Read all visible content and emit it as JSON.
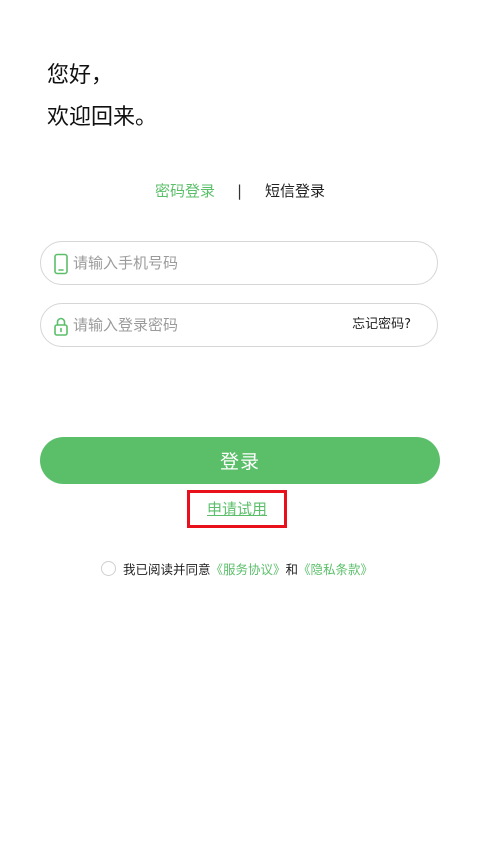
{
  "greeting": {
    "line1": "您好，",
    "line2": "欢迎回来。"
  },
  "login_tabs": {
    "password_label": "密码登录",
    "divider": "|",
    "sms_label": "短信登录"
  },
  "phone_field": {
    "placeholder": "请输入手机号码",
    "icon": "phone-icon",
    "value": ""
  },
  "password_field": {
    "placeholder": "请输入登录密码",
    "icon": "lock-icon",
    "value": "",
    "forgot_label": "忘记密码?"
  },
  "login_button": {
    "label": "登录"
  },
  "trial_link": {
    "label": "申请试用"
  },
  "agreement": {
    "prefix": "我已阅读并同意",
    "service_link": "《服务协议》",
    "conjunction": "和",
    "privacy_link": "《隐私条款》",
    "checked": false
  },
  "colors": {
    "accent": "#5bbf6a",
    "highlight_border": "#e8101a",
    "field_border": "#d6d6d6",
    "placeholder": "#9b9b9b"
  }
}
